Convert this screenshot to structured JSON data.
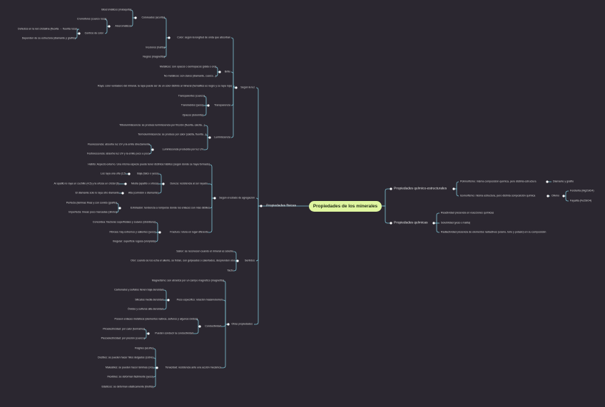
{
  "colors": {
    "background": "#2b2730",
    "branch_line": "#7ec3d4",
    "root_fill": "#dff6a0",
    "text": "#d8d8d8"
  },
  "root": "Propiedades de los minerales",
  "left": {
    "fisicas": "Propiedades físicas",
    "segun_luz": "Según la luz",
    "color_sentido": "Color: según la longitud de onda que absorban",
    "coloreados": "Coloreados (azurita)",
    "idiocromaticos": "Idiocromáticos (malaquita)",
    "alocromaticos": "Alocromáticos",
    "cromoforos": "Cromóforos (cuarzo rosa)",
    "centros_color": "Centros de color",
    "defectos": "Defectos en la red cristalina (fluorita → fluorita rosa)",
    "dependen": "Dependen de su estructura (diamante y grafito)",
    "incoloros": "Incoloros (halita)",
    "negros": "Negros (magnetita)",
    "brillo": "Brillo",
    "metalicos": "Metálicos: son opacos o semiopacos (plata o oro)",
    "no_metalicos": "No metálicos: son claros (diamante, cuarzo...)",
    "raya": "Raya: color verdadero del mineral, la raya puede ser de un color distinto al mineral (hematites es negro y su raya roja)",
    "transparencia": "Transparencia",
    "transparentes": "Transparentes (cuarzo)",
    "translucidos": "Translúcidos (yeso)",
    "opacos": "Opacos (dolomita)",
    "luminiscencia": "Luminiscencia",
    "triboluminiscencia": "Triboluminiscencia: se produce luminiscencia por fricción (fluorita, calcita...)",
    "termoluminiscencia": "Termoluminiscencia: se produce por calor (calcita, fluorita...)",
    "uv": "Luminiscencia producida por luz UV",
    "fluorescencia": "Fluorescencia: absorbe luz UV y la emite directamente",
    "fosforescencia": "Fosforescencia: absorbe luz UV y la emite poco a poco",
    "agregacion": "Según el estado de agregación",
    "habito": "Hábito: Aspecto externo. Una misma especie puede tener distintos hábitos (según donde se haya formado)",
    "dureza": "Dureza: resistencia al ser rayado",
    "baja": "Baja (talco o yeso)",
    "media": "Media (apatito u ortosa)",
    "alta": "Alta (corindón o diamante)",
    "baja_desc": "Los raya una uña (2,5",
    "media_desc": "Al apatito lo raya un cuchillo (4,5) y la ortosa un cristal (6)",
    "alta_desc": "El diamante solo lo raya otro diamante",
    "exfoliacion": "Exfoliación: tendencia a romperse donde los enlaces son más débiles",
    "perfecta": "Perfecta (láminas finas y con sonido (grafito)",
    "imperfecta": "Imperfecta: líneas poco marcadas (olivino)",
    "fractura": "Fractura: rotura en lugar diferente",
    "concoidea": "Concoidea: fracturas superficiales y suaves (obsidiana)",
    "fibrosa": "Fibrosa: hay extremos y salientes (yeso)",
    "irregular": "Irregular: superficie rugosa (oro/plata)",
    "sentidos": "Sentidos",
    "sabor": "Sabor: se reconocen cuando el mineral es soluble",
    "olor": "Olor: cuando se los echa el aliento, se frotan, son golpeados o calentados, desprenden olor",
    "tacto": "Tacto",
    "otras": "Otras propiedades",
    "magnetismo": "Magnetismo: son atraídos por un campo magnético (magnetita)",
    "peso": "Peso específico: relación masa/volumen",
    "carbonatos": "Carbonatos y sulfatos tienen baja densidad",
    "silicatos": "Silicatos media densidad",
    "oxidos": "Óxidos y sulfuros alta densidad",
    "conductividad": "Conductividad",
    "enlaces_metalicos": "Poseen enlaces metálicos (elementos nativos, sulfuros y algunos óxidos)",
    "conducir": "Pueden conducir la conductividad",
    "piroelectricidad": "Piroelectricidad: por calor (turmalina)",
    "piezoelectricidad": "Piezoelectricidad: por presión (cuarzo)",
    "tenacidad": "Tenacidad: resistencia ante una acción mecánica",
    "fragiles": "Frágiles (azufre)",
    "ductiles": "Dúctiles: se pueden hacer hilos delgados (cobre)",
    "maleables": "Maleables: se pueden hacer láminas (oro)",
    "flexibles": "Flexibles: se deforman fácilmente (yeso)",
    "elasticos": "Elásticos: se deforman elásticamente (biotita)"
  },
  "right": {
    "quimico_estructurales": "Propiedades químico-estructurales",
    "polimorfismo": "Polimorfismo: misma composición química, pero distinta estructura",
    "polimorfismo_ej": "Diamante y grafito",
    "isomorfismo": "Isomorfismo: misma estructura, pero distinta composición química",
    "olivino": "Olivino",
    "forsterita": "Forsterita (Mg2SiO4)",
    "fayalita": "Fayalita (Fe2SiO4)",
    "quimicas": "Propiedades químicas",
    "reactividad": "Reactividad presencia en reacciones químicas",
    "solubilidad": "Solubilidad (yeso o halita)",
    "radiactividad": "Radiactividad presencia de elementos radiactivos (uranio, torio y potasio) en su composición"
  }
}
